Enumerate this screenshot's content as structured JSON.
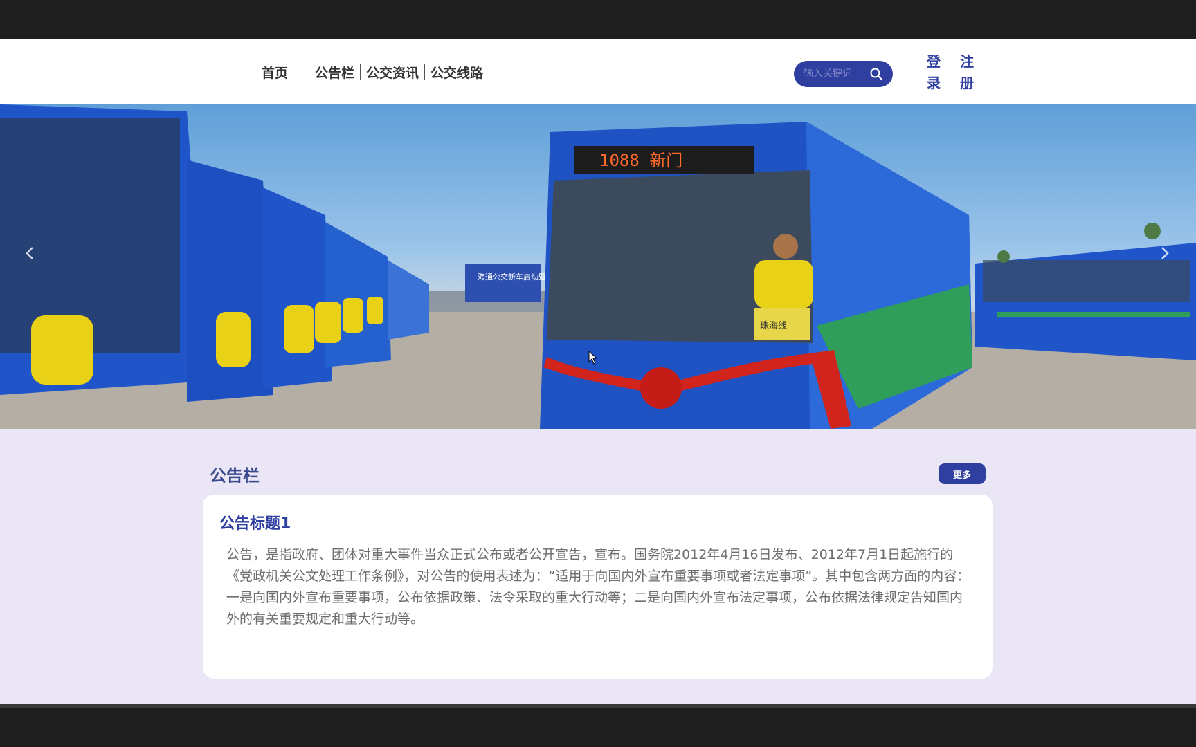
{
  "nav": {
    "items": [
      {
        "label": "首页"
      },
      {
        "label": "公告栏"
      },
      {
        "label": "公交资讯"
      },
      {
        "label": "公交线路"
      }
    ]
  },
  "search": {
    "placeholder": "输入关键词",
    "icon": "search-icon"
  },
  "auth": {
    "login_label": "登录",
    "register_label": "注册"
  },
  "banner": {
    "bus_sign": "1088 新门",
    "event_board": "海通公交新车启动暨公交",
    "plate_text": "珠海线"
  },
  "announcement": {
    "section_title": "公告栏",
    "more_label": "更多",
    "card_title": "公告标题1",
    "card_body": "公告，是指政府、团体对重大事件当众正式公布或者公开宣告，宣布。国务院2012年4月16日发布、2012年7月1日起施行的《党政机关公文处理工作条例》，对公告的使用表述为：“适用于向国内外宣布重要事项或者法定事项”。其中包含两方面的内容：一是向国内外宣布重要事项，公布依据政策、法令采取的重大行动等；二是向国内外宣布法定事项，公布依据法律规定告知国内外的有关重要规定和重大行动等。"
  },
  "colors": {
    "brand": "#2f3fa0",
    "content_bg": "#eae6f6",
    "dark_frame": "#1e1e1e"
  }
}
